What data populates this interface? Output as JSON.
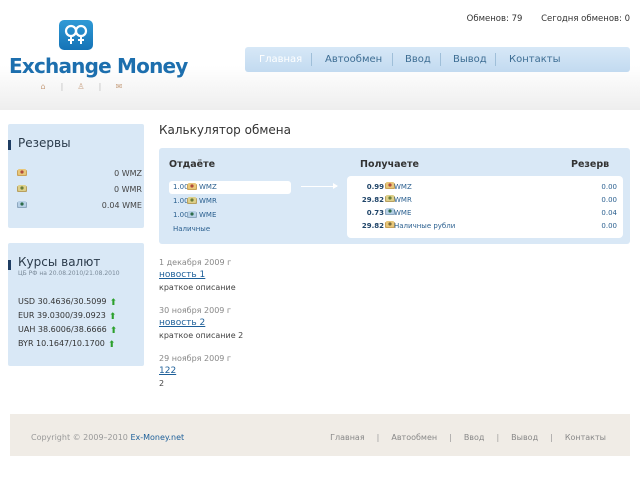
{
  "header": {
    "logo_text": "Exchange Money",
    "stats": {
      "exchanges": "Обменов: 79",
      "today": "Сегодня обменов: 0"
    },
    "nav": [
      "Главная",
      "Автообмен",
      "Ввод",
      "Вывод",
      "Контакты"
    ],
    "nav_active": "Главная",
    "mini_icons": [
      "home-icon",
      "users-icon",
      "mail-icon"
    ]
  },
  "reserves": {
    "title": "Резервы",
    "items": [
      {
        "currency": "WMZ",
        "value": "0 WMZ",
        "icon": "wmz-coin-icon"
      },
      {
        "currency": "WMR",
        "value": "0 WMR",
        "icon": "wmr-coin-icon"
      },
      {
        "currency": "WME",
        "value": "0.04 WME",
        "icon": "wme-coin-icon"
      }
    ]
  },
  "rates": {
    "title": "Курсы валют",
    "subtitle": "ЦБ РФ на 20.08.2010/21.08.2010",
    "items": [
      {
        "text": "USD 30.4636/30.5099",
        "trend": "up"
      },
      {
        "text": "EUR 39.0300/39.0923",
        "trend": "up"
      },
      {
        "text": "UAH 38.6006/38.6666",
        "trend": "up"
      },
      {
        "text": "BYR 10.1647/10.1700",
        "trend": "up"
      }
    ]
  },
  "calculator": {
    "title": "Калькулятор обмена",
    "col_give": "Отдаёте",
    "col_receive": "Получаете",
    "col_reserve": "Резерв",
    "give": [
      {
        "amount": "1.00",
        "currency": "WMZ",
        "selected": true
      },
      {
        "amount": "1.00",
        "currency": "WMR",
        "selected": false
      },
      {
        "amount": "1.00",
        "currency": "WME",
        "selected": false
      },
      {
        "amount": "",
        "currency": "Наличные",
        "selected": false
      }
    ],
    "receive": [
      {
        "amount": "0.99",
        "currency": "WMZ",
        "reserve": "0.00"
      },
      {
        "amount": "29.82",
        "currency": "WMR",
        "reserve": "0.00"
      },
      {
        "amount": "0.73",
        "currency": "WME",
        "reserve": "0.04"
      },
      {
        "amount": "29.82",
        "currency": "Наличные рубли",
        "reserve": "0.00"
      }
    ]
  },
  "news": [
    {
      "date": "1 декабря 2009 г",
      "title": "новость 1",
      "desc": "краткое описание"
    },
    {
      "date": "30 ноября 2009 г",
      "title": "новость 2",
      "desc": "краткое описание 2"
    },
    {
      "date": "29 ноября 2009 г",
      "title": "122",
      "desc": "2"
    }
  ],
  "footer": {
    "copyright": "Copyright © 2009–2010",
    "site": "Ex-Money.net",
    "nav": [
      "Главная",
      "Автообмен",
      "Ввод",
      "Вывод",
      "Контакты"
    ]
  },
  "colors": {
    "accent": "#1d6fae",
    "panel_bg": "#d9e8f6",
    "nav_bg": "#c9def2",
    "trend_up": "#2ca02c"
  }
}
